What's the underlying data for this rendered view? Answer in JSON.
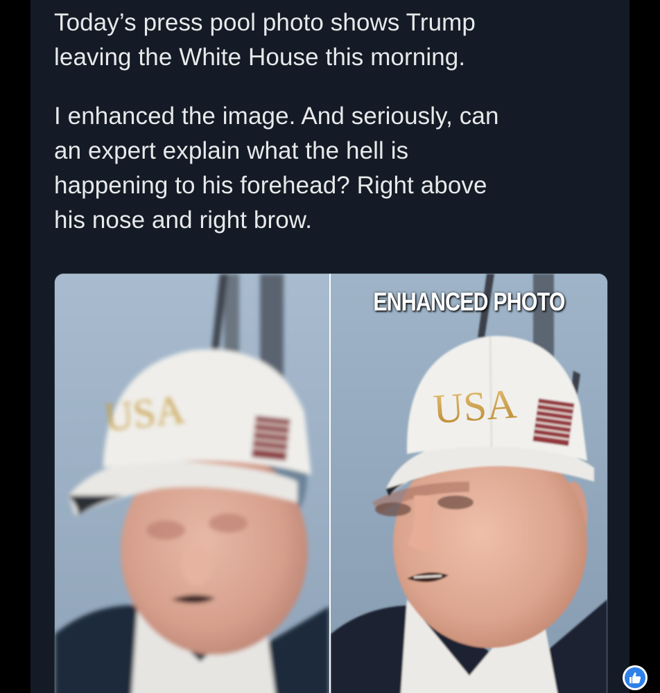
{
  "post": {
    "paragraphs": [
      "Today’s press pool photo shows Trump leaving the White House this morning.",
      "I enhanced the image. And  seriously, can an expert explain what the hell is happening to his forehead? Right above his nose and right brow."
    ],
    "lines": [
      "Today’s press pool photo shows Trump",
      "leaving the White House this morning.",
      "I enhanced the image. And  seriously, can",
      "an expert explain what the hell is",
      "happening to his forehead? Right above",
      "his nose and right brow."
    ]
  },
  "media": {
    "left_panel": {
      "hat_text": "USA"
    },
    "right_panel": {
      "overlay_label": "ENHANCED PHOTO",
      "hat_text": "USA"
    }
  },
  "reaction": {
    "icon": "thumbs-up-icon"
  },
  "colors": {
    "background": "#141b26",
    "text": "#e7e9ea",
    "hat": "#efeeea",
    "hat_lettering": "#c9a04a",
    "sky": "#9db0c4",
    "reaction_badge": "#2f80e8"
  }
}
